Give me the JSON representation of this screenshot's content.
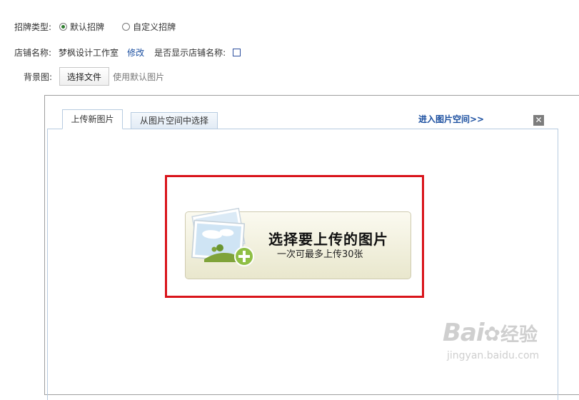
{
  "sign": {
    "label": "招牌类型:",
    "options": [
      {
        "label": "默认招牌",
        "selected": true
      },
      {
        "label": "自定义招牌",
        "selected": false
      }
    ]
  },
  "shop": {
    "label": "店铺名称:",
    "name": "梦枫设计工作室",
    "edit_link": "修改",
    "show_label": "是否显示店铺名称:",
    "show_checked": false
  },
  "background": {
    "label": "背景图:",
    "choose_button": "选择文件",
    "status": "使用默认图片"
  },
  "dialog": {
    "tabs": [
      {
        "label": "上传新图片",
        "active": true
      },
      {
        "label": "从图片空间中选择",
        "active": false
      }
    ],
    "enter_link": "进入图片空间>>",
    "close_symbol": "✕",
    "upload": {
      "title": "选择要上传的图片",
      "subtitle": "一次可最多上传30张"
    }
  },
  "watermark": {
    "brand": "Bai",
    "brand_tail": "经验",
    "url": "jingyan.baidu.com"
  },
  "colors": {
    "link": "#1b4fa0",
    "highlight": "#d9141b",
    "tab_border": "#b7cbe0"
  }
}
